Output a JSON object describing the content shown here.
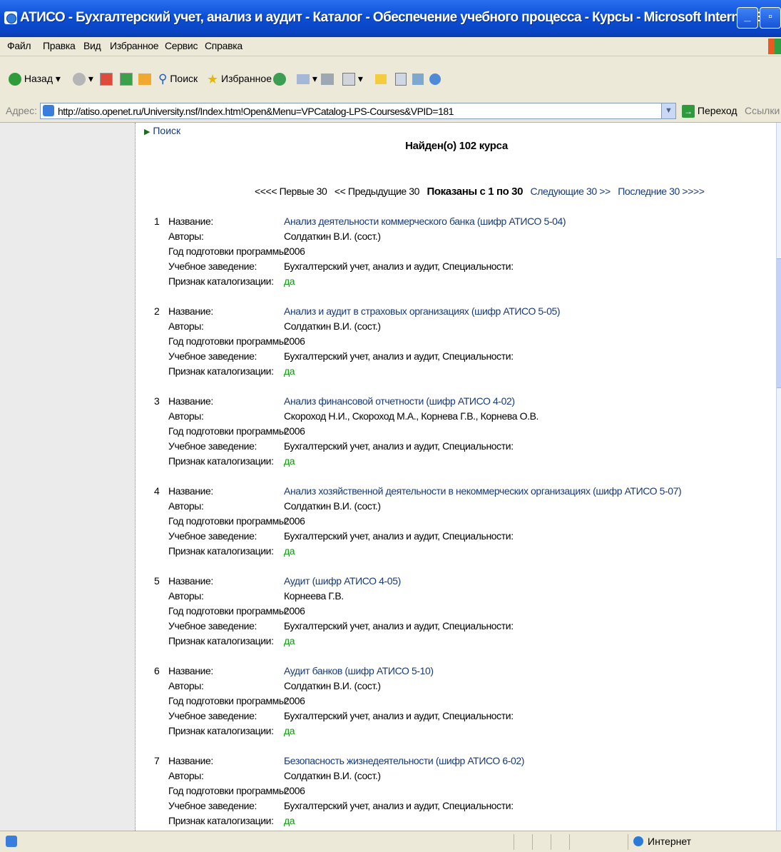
{
  "window": {
    "title": "АТИСО - Бухгалтерский учет, анализ и аудит - Каталог - Обеспечение учебного процесса - Курсы - Microsoft Internet Explorer"
  },
  "menu": [
    "Файл",
    "Правка",
    "Вид",
    "Избранное",
    "Сервис",
    "Справка"
  ],
  "toolbar": {
    "back": "Назад",
    "search": "Поиск",
    "favorites": "Избранное"
  },
  "address": {
    "label": "Адрес:",
    "url": "http://atiso.openet.ru/University.nsf/Index.htm!Open&Menu=VPCatalog-LPS-Courses&VPID=181",
    "go": "Переход",
    "links": "Ссылки"
  },
  "page": {
    "search_link": "Поиск",
    "found_text": "Найден(о) 102 курса",
    "pager": {
      "first": "<<<< Первые 30",
      "prev": "<< Предыдущие 30",
      "current": "Показаны с 1 по 30",
      "next": "Следующие 30 >>",
      "last": "Последние 30 >>>>"
    },
    "labels": {
      "name": "Название:",
      "authors": "Авторы:",
      "year": "Год подготовки программы:",
      "institution": "Учебное заведение:",
      "cataloged": "Признак каталогизации:"
    },
    "courses": [
      {
        "num": "1",
        "name": "Анализ деятельности коммерческого банка (шифр АТИСО 5-04)",
        "authors": "Солдаткин В.И. (сост.)",
        "year": "2006",
        "institution": "Бухгалтерский учет, анализ и аудит, Специальности:",
        "cataloged": "да"
      },
      {
        "num": "2",
        "name": "Анализ и аудит в страховых организациях (шифр АТИСО 5-05)",
        "authors": "Солдаткин В.И. (сост.)",
        "year": "2006",
        "institution": "Бухгалтерский учет, анализ и аудит, Специальности:",
        "cataloged": "да"
      },
      {
        "num": "3",
        "name": "Анализ финансовой отчетности (шифр АТИСО 4-02)",
        "authors": "Скороход Н.И., Скороход М.А., Корнева Г.В., Корнева О.В.",
        "year": "2006",
        "institution": "Бухгалтерский учет, анализ и аудит, Специальности:",
        "cataloged": "да"
      },
      {
        "num": "4",
        "name": "Анализ хозяйственной деятельности в некоммерческих организациях (шифр АТИСО 5-07)",
        "authors": "Солдаткин В.И. (сост.)",
        "year": "2006",
        "institution": "Бухгалтерский учет, анализ и аудит, Специальности:",
        "cataloged": "да"
      },
      {
        "num": "5",
        "name": "Аудит (шифр АТИСО 4-05)",
        "authors": "Корнеева Г.В.",
        "year": "2006",
        "institution": "Бухгалтерский учет, анализ и аудит, Специальности:",
        "cataloged": "да"
      },
      {
        "num": "6",
        "name": "Аудит банков (шифр АТИСО 5-10)",
        "authors": "Солдаткин В.И. (сост.)",
        "year": "2006",
        "institution": "Бухгалтерский учет, анализ и аудит, Специальности:",
        "cataloged": "да"
      },
      {
        "num": "7",
        "name": "Безопасность жизнедеятельности (шифр АТИСО 6-02)",
        "authors": "Солдаткин В.И. (сост.)",
        "year": "2006",
        "institution": "Бухгалтерский учет, анализ и аудит, Специальности:",
        "cataloged": "да"
      }
    ]
  },
  "status": {
    "zone": "Интернет"
  }
}
